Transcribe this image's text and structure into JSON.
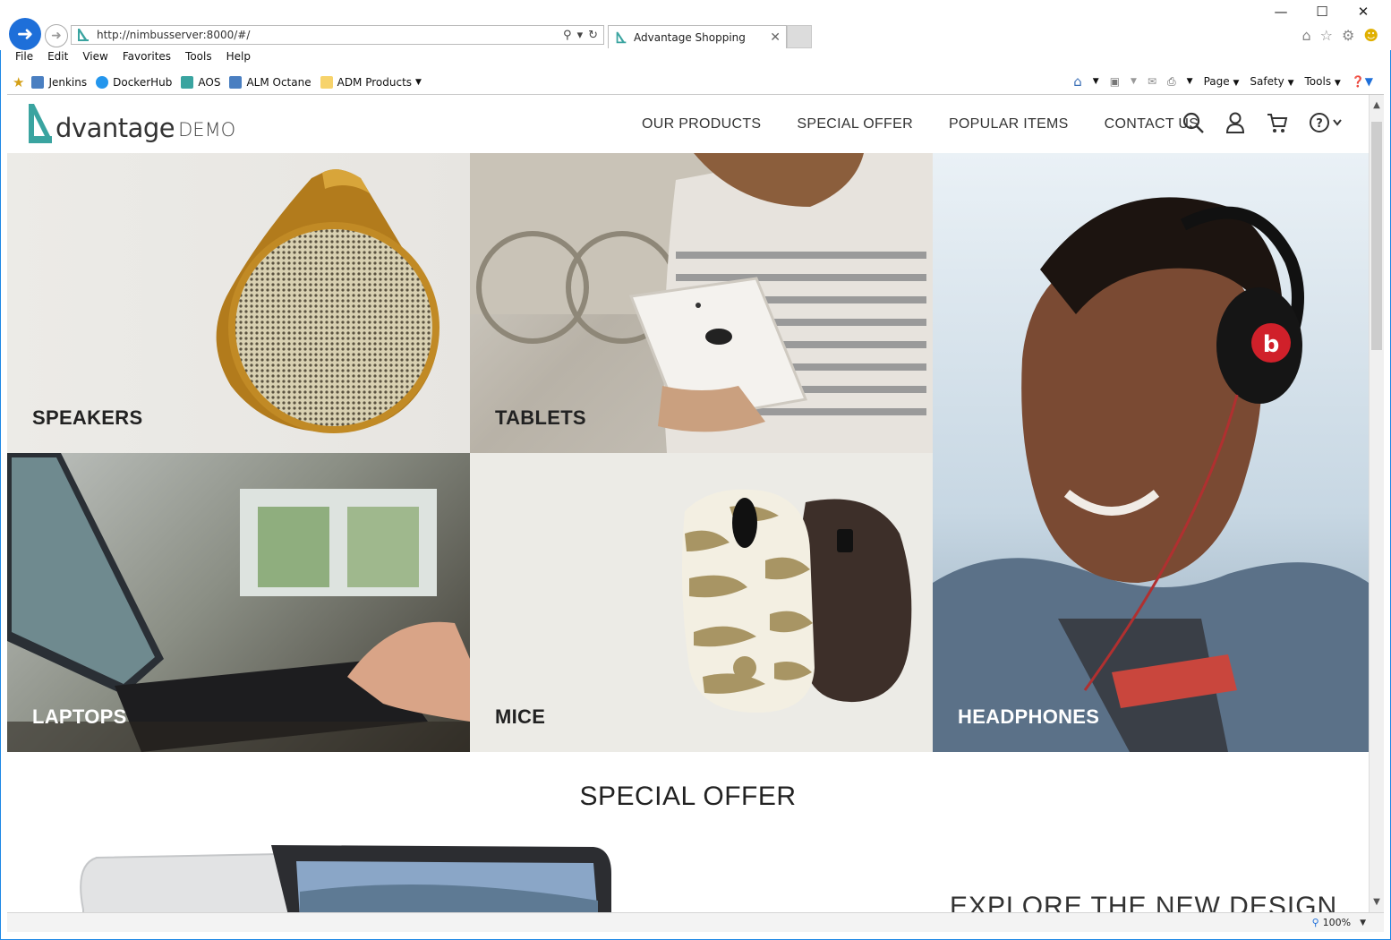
{
  "browser": {
    "address_url": "http://nimbusserver:8000/#/",
    "tab_title": "Advantage Shopping",
    "menu": [
      "File",
      "Edit",
      "View",
      "Favorites",
      "Tools",
      "Help"
    ],
    "favorites": [
      "Jenkins",
      "DockerHub",
      "AOS",
      "ALM Octane",
      "ADM Products"
    ],
    "command_bar": [
      "Page",
      "Safety",
      "Tools"
    ],
    "zoom": "100%"
  },
  "site": {
    "logo_main": "dvantage",
    "logo_suffix": "DEMO",
    "nav": [
      "OUR PRODUCTS",
      "SPECIAL OFFER",
      "POPULAR ITEMS",
      "CONTACT US"
    ]
  },
  "categories": {
    "speakers": "SPEAKERS",
    "tablets": "TABLETS",
    "headphones": "HEADPHONES",
    "laptops": "LAPTOPS",
    "mice": "MICE"
  },
  "special_offer": {
    "title": "SPECIAL OFFER",
    "headline": "EXPLORE THE NEW DESIGN"
  },
  "colors": {
    "accent": "#3aa4a0",
    "ie_blue": "#1e6fd9"
  }
}
